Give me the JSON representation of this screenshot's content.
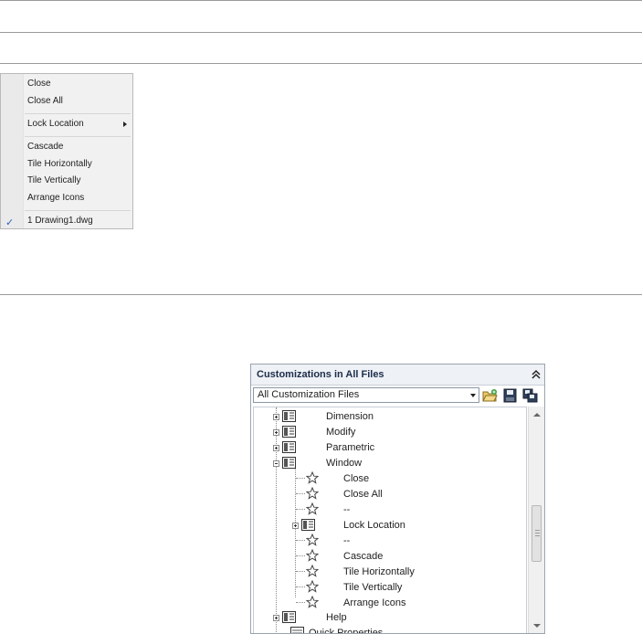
{
  "window_menu": {
    "items": [
      {
        "label": "Close"
      },
      {
        "label": "Close All"
      },
      {
        "label": "Lock Location",
        "submenu": true
      },
      {
        "label": "Cascade"
      },
      {
        "label": "Tile Horizontally"
      },
      {
        "label": "Tile Vertically"
      },
      {
        "label": "Arrange Icons"
      },
      {
        "label": "1 Drawing1.dwg",
        "checked": true
      }
    ],
    "check_glyph": "✓",
    "check_color": "#2b63b8"
  },
  "customize_panel": {
    "title": "Customizations in All Files",
    "collapse_icon": "double-chevron-up-icon",
    "filter": {
      "selected": "All Customization Files"
    },
    "toolbar_icons": [
      "open-folder-icon",
      "save-icon",
      "save-as-icon"
    ],
    "tree": {
      "menus": [
        {
          "label": "Dimension",
          "expanded": false
        },
        {
          "label": "Modify",
          "expanded": false
        },
        {
          "label": "Parametric",
          "expanded": false
        },
        {
          "label": "Window",
          "expanded": true
        },
        {
          "label": "Help",
          "expanded": false
        }
      ],
      "window_children": [
        {
          "label": "Close",
          "type": "command"
        },
        {
          "label": "Close All",
          "type": "command"
        },
        {
          "label": "--",
          "type": "separator"
        },
        {
          "label": "Lock Location",
          "type": "submenu"
        },
        {
          "label": "--",
          "type": "separator"
        },
        {
          "label": "Cascade",
          "type": "command"
        },
        {
          "label": "Tile Horizontally",
          "type": "command"
        },
        {
          "label": "Tile Vertically",
          "type": "command"
        },
        {
          "label": "Arrange Icons",
          "type": "command"
        }
      ],
      "partial_bottom_item": "Quick Properties"
    }
  }
}
